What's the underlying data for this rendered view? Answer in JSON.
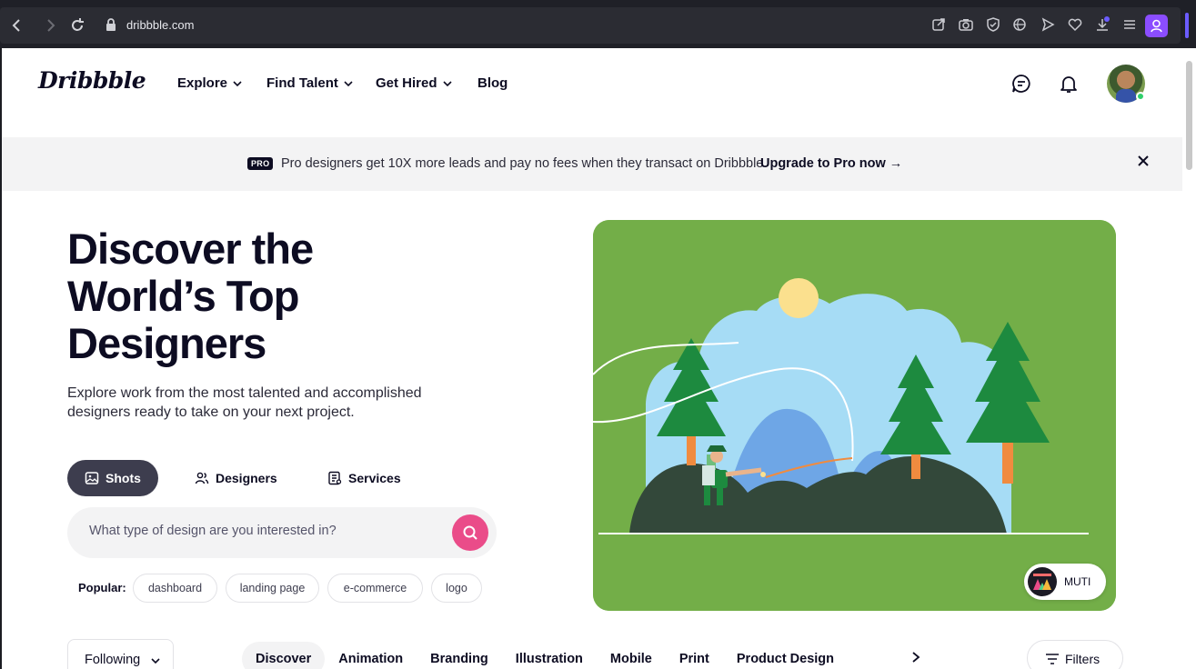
{
  "browser": {
    "url": "dribbble.com",
    "icons": [
      "back-icon",
      "forward-icon",
      "reload-icon",
      "lock-icon",
      "share-icon",
      "camera-icon",
      "shield-icon",
      "translate-icon",
      "send-icon",
      "heart-icon",
      "download-icon",
      "menu-icon",
      "profile-icon"
    ]
  },
  "header": {
    "logo": "Dribbble",
    "nav": [
      {
        "label": "Explore",
        "dropdown": true
      },
      {
        "label": "Find Talent",
        "dropdown": true
      },
      {
        "label": "Get Hired",
        "dropdown": true
      },
      {
        "label": "Blog",
        "dropdown": false
      }
    ]
  },
  "banner": {
    "badge": "PRO",
    "message": "Pro designers get 10X more leads and pay no fees when they transact on Dribbble.",
    "cta": "Upgrade to Pro now →"
  },
  "hero": {
    "title": "Discover the World’s Top Designers",
    "subtitle": "Explore work from the most talented and accomplished designers ready to take on your next project.",
    "segments": [
      {
        "label": "Shots",
        "active": true
      },
      {
        "label": "Designers",
        "active": false
      },
      {
        "label": "Services",
        "active": false
      }
    ],
    "search_placeholder": "What type of design are you interested in?",
    "popular_label": "Popular:",
    "popular_tags": [
      "dashboard",
      "landing page",
      "e-commerce",
      "logo"
    ],
    "credit": "MUTI"
  },
  "filter_bar": {
    "following": "Following",
    "categories": [
      "Discover",
      "Animation",
      "Branding",
      "Illustration",
      "Mobile",
      "Print",
      "Product Design"
    ],
    "active_category": "Discover",
    "filters_label": "Filters"
  },
  "colors": {
    "brand_pink": "#ea4c89",
    "dark": "#0d0c22",
    "illustration_green": "#73ae48"
  }
}
